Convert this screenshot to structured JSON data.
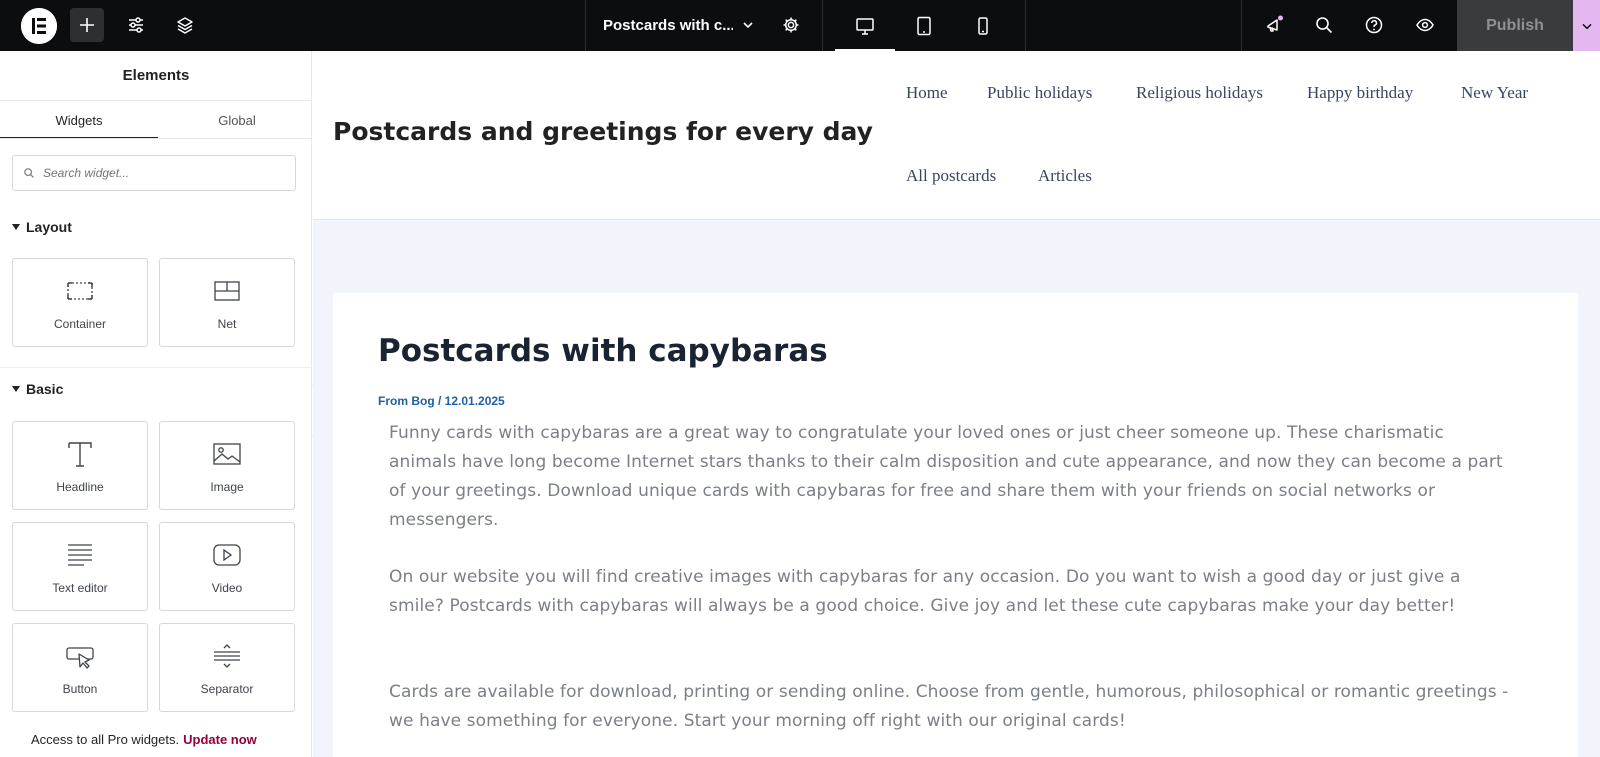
{
  "topbar": {
    "document_title": "Postcards with c...",
    "publish_label": "Publish",
    "icons": {
      "logo": "elementor-logo-icon",
      "add": "plus-icon",
      "settings": "sliders-icon",
      "structure": "layers-icon",
      "page_settings": "gear-icon",
      "desktop": "desktop-icon",
      "tablet": "tablet-icon",
      "mobile": "mobile-icon",
      "whats_new": "megaphone-icon",
      "finder": "search-icon",
      "help": "help-icon",
      "preview": "eye-icon",
      "publish_options": "chevron-down-icon"
    }
  },
  "sidebar": {
    "title": "Elements",
    "tabs": [
      {
        "label": "Widgets",
        "active": true
      },
      {
        "label": "Global",
        "active": false
      }
    ],
    "search_placeholder": "Search widget...",
    "categories": [
      {
        "label": "Layout",
        "widgets": [
          {
            "label": "Container",
            "icon": "container-icon"
          },
          {
            "label": "Net",
            "icon": "grid-icon"
          }
        ]
      },
      {
        "label": "Basic",
        "widgets": [
          {
            "label": "Headline",
            "icon": "heading-icon"
          },
          {
            "label": "Image",
            "icon": "image-icon"
          },
          {
            "label": "Text editor",
            "icon": "text-editor-icon"
          },
          {
            "label": "Video",
            "icon": "video-icon"
          },
          {
            "label": "Button",
            "icon": "button-icon"
          },
          {
            "label": "Separator",
            "icon": "divider-icon"
          }
        ]
      }
    ],
    "promo_text": "Access to all Pro widgets.",
    "promo_link": "Update now"
  },
  "site": {
    "title": "Postcards and greetings for every day",
    "nav": [
      "Home",
      "Public holidays",
      "Religious holidays",
      "Happy birthday",
      "New Year",
      "All postcards",
      "Articles"
    ]
  },
  "post": {
    "title": "Postcards with capybaras",
    "meta": "From Bog / 12.01.2025",
    "paragraphs": [
      "Funny cards with capybaras are a great way to congratulate your loved ones or just cheer someone up. These charismatic animals have long become Internet stars thanks to their calm disposition and cute appearance, and now they can become a part of your greetings. Download unique cards with capybaras for free and share them with your friends on social networks or messengers.",
      "On our website you will find creative images with capybaras for any occasion. Do you want to wish a good day or just give a smile? Postcards with capybaras will always be a good choice. Give joy and let these cute capybaras make your day better!",
      "Cards are available for download, printing or sending online. Choose from gentle, humorous, philosophical or romantic greetings - we have something for everyone. Start your morning off right with our original cards!"
    ]
  },
  "colors": {
    "topbar_bg": "#0c0d0e",
    "publish_caret": "#e5b7f0",
    "promo_link": "#93003f",
    "meta_link": "#1f5fa8",
    "canvas_bg": "#f1f5fb"
  }
}
